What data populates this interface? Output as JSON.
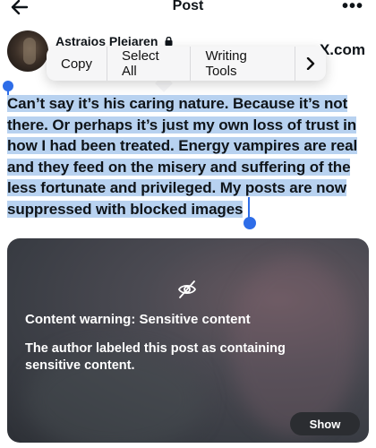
{
  "header": {
    "title": "Post",
    "back_icon": "arrow-left-icon",
    "more_label": "•••"
  },
  "author": {
    "name": "Astraios Pleiaren",
    "lock_icon": "lock-icon",
    "trailing_text": "X.com"
  },
  "context_menu": {
    "items": [
      "Copy",
      "Select All",
      "Writing Tools"
    ],
    "next_label": "›"
  },
  "post": {
    "text": "Can’t say it’s his caring nature. Because it’s not there. Or perhaps it’s just my own loss of trust in how I had been treated. Energy vampires are real and they feed on the misery and suffering of the less fortunate and privileged. My posts are now suppressed with blocked images"
  },
  "media": {
    "icon": "eye-off-icon",
    "warning_title": "Content warning: Sensitive content",
    "warning_body": "The author labeled this post as containing sensitive content.",
    "show_label": "Show"
  },
  "colors": {
    "selection": "#b8d2f0",
    "handle": "#2e6de8",
    "menu_bg": "#f6f6f7"
  }
}
